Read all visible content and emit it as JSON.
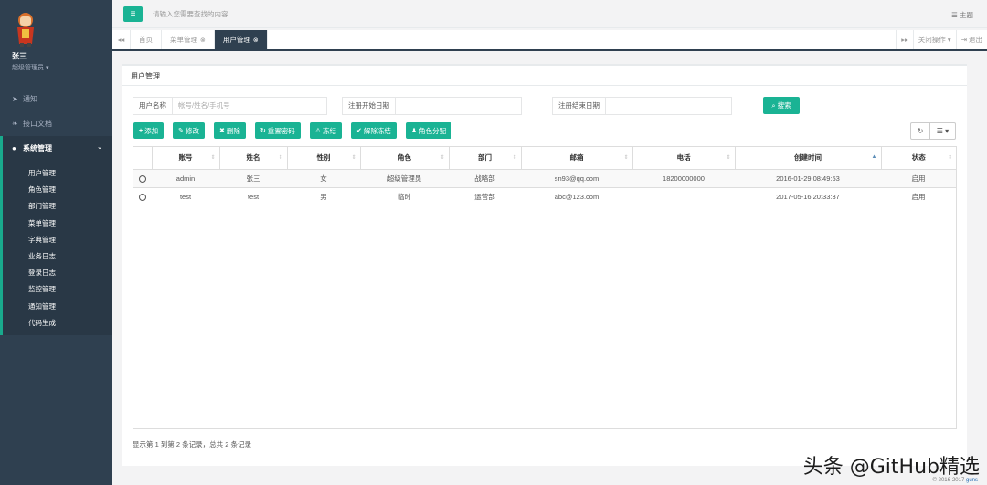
{
  "user": {
    "name": "张三",
    "role": "超级管理员 ▾"
  },
  "sidebar": {
    "items": [
      {
        "label": "通知",
        "icon": "paper-plane-icon"
      },
      {
        "label": "接口文档",
        "icon": "leaf-icon"
      },
      {
        "label": "系统管理",
        "icon": "user-icon"
      }
    ],
    "sub_items": [
      "用户管理",
      "角色管理",
      "部门管理",
      "菜单管理",
      "字典管理",
      "业务日志",
      "登录日志",
      "监控管理",
      "通知管理",
      "代码生成"
    ]
  },
  "topbar": {
    "search_placeholder": "请输入您需要查找的内容 …",
    "theme_label": "主题"
  },
  "tabs": {
    "items": [
      {
        "label": "首页",
        "closable": false
      },
      {
        "label": "菜单管理",
        "closable": true
      },
      {
        "label": "用户管理",
        "closable": true
      }
    ],
    "close_ops": "关闭操作 ▾",
    "logout": "退出"
  },
  "panel": {
    "title": "用户管理"
  },
  "search": {
    "fields": [
      {
        "label": "用户名称",
        "placeholder": "帐号/姓名/手机号"
      },
      {
        "label": "注册开始日期",
        "placeholder": ""
      },
      {
        "label": "注册结束日期",
        "placeholder": ""
      }
    ],
    "button": "搜索"
  },
  "toolbar": [
    {
      "label": "添加",
      "icon": "+"
    },
    {
      "label": "修改",
      "icon": "✎"
    },
    {
      "label": "删除",
      "icon": "✖"
    },
    {
      "label": "重置密码",
      "icon": "↻"
    },
    {
      "label": "冻结",
      "icon": "⚠"
    },
    {
      "label": "解除冻结",
      "icon": "✔"
    },
    {
      "label": "角色分配",
      "icon": "♟"
    }
  ],
  "table": {
    "columns": [
      "账号",
      "姓名",
      "性别",
      "角色",
      "部门",
      "邮箱",
      "电话",
      "创建时间",
      "状态"
    ],
    "rows": [
      [
        "admin",
        "张三",
        "女",
        "超级管理员",
        "战略部",
        "sn93@qq.com",
        "18200000000",
        "2016-01-29 08:49:53",
        "启用"
      ],
      [
        "test",
        "test",
        "男",
        "临时",
        "运营部",
        "abc@123.com",
        "",
        "2017-05-16 20:33:37",
        "启用"
      ]
    ]
  },
  "pagination": {
    "info": "显示第 1 到第 2 条记录，总共 2 条记录"
  },
  "footer": {
    "copyright": "© 2016-2017 ",
    "brand": "guns"
  },
  "watermark": "头条 @GitHub精选",
  "colors": {
    "accent": "#1ab394",
    "sidebar": "#2f4050"
  }
}
